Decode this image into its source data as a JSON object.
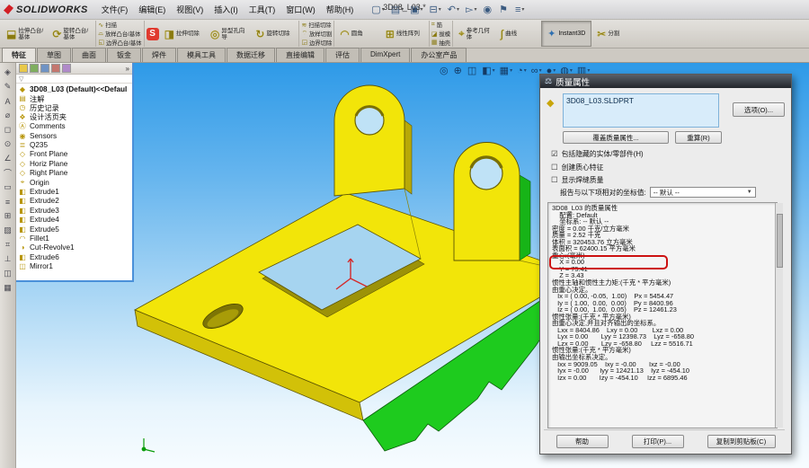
{
  "window": {
    "logo": "SOLIDWORKS",
    "doc_title": "3D08_L03 *"
  },
  "menus": [
    "文件(F)",
    "编辑(E)",
    "视图(V)",
    "插入(I)",
    "工具(T)",
    "窗口(W)",
    "帮助(H)"
  ],
  "std_toolbar": [
    {
      "glyph": "▢",
      "caret": "▾"
    },
    {
      "glyph": "▤",
      "caret": "▾"
    },
    {
      "glyph": "▣",
      "caret": "▾"
    },
    {
      "glyph": "⊟",
      "caret": "▾"
    },
    {
      "glyph": "↶",
      "caret": "▾"
    },
    {
      "glyph": "▻",
      "caret": "▾"
    },
    {
      "glyph": "◉",
      "caret": ""
    },
    {
      "glyph": "⚑",
      "caret": ""
    },
    {
      "glyph": "≡",
      "caret": "▾"
    }
  ],
  "features_toolbar": {
    "big1": [
      {
        "glyph": "⬓",
        "label": "拉伸凸台/基体"
      },
      {
        "glyph": "⟳",
        "label": "旋转凸台/基体"
      }
    ],
    "stack1": [
      {
        "glyph": "∿",
        "label": "扫描"
      },
      {
        "glyph": "⌓",
        "label": "放样凸台/基体"
      },
      {
        "glyph": "◱",
        "label": "边界凸台/基体"
      }
    ],
    "big2": [
      {
        "glyph": "◨",
        "label": "拉伸切除"
      },
      {
        "glyph": "◎",
        "label": "异型孔向导"
      },
      {
        "glyph": "↻",
        "label": "旋转切除"
      }
    ],
    "stack2": [
      {
        "glyph": "≋",
        "label": "扫描切除"
      },
      {
        "glyph": "⌔",
        "label": "放样切割"
      },
      {
        "glyph": "◲",
        "label": "边界切除"
      }
    ],
    "big3": [
      {
        "glyph": "◠",
        "label": "圆角"
      },
      {
        "glyph": "⊞",
        "label": "线性阵列"
      }
    ],
    "stack3": [
      {
        "glyph": "⌗",
        "label": "筋"
      },
      {
        "glyph": "◪",
        "label": "拔模"
      },
      {
        "glyph": "▦",
        "label": "抽壳"
      }
    ],
    "big4": [
      {
        "glyph": "⌖",
        "label": "参考几何体"
      },
      {
        "glyph": "∫",
        "label": "曲线"
      }
    ],
    "addin_badge": "S",
    "instant3d_label": "Instant3D",
    "split_label": "分割"
  },
  "command_tabs": {
    "active": "特征",
    "others": [
      "草图",
      "曲面",
      "钣金",
      "焊件",
      "模具工具",
      "数据迁移",
      "直接编辑",
      "评估",
      "DimXpert",
      "办公室产品"
    ]
  },
  "left_strip": [
    "◈",
    "✎",
    "A",
    "⌀",
    "◻",
    "⊙",
    "∠",
    "⌒",
    "▭",
    "≡",
    "⊞",
    "▨",
    "⌗",
    "⊥",
    "◫",
    "▦"
  ],
  "feature_tree": {
    "chevron": "»",
    "filter_glyph": "▽",
    "root": "3D08_L03 (Default)<<Defaul",
    "items": [
      {
        "icon": "▤",
        "label": "注解",
        "plane": false
      },
      {
        "icon": "◷",
        "label": "历史记录",
        "plane": false
      },
      {
        "icon": "❖",
        "label": "设计活页夹",
        "plane": false
      },
      {
        "icon": "Ⓐ",
        "label": "Comments",
        "plane": false
      },
      {
        "icon": "◉",
        "label": "Sensors",
        "plane": false
      },
      {
        "icon": "≣",
        "label": "Q235",
        "plane": false
      },
      {
        "icon": "◇",
        "label": "Front Plane",
        "plane": true
      },
      {
        "icon": "◇",
        "label": "Horiz Plane",
        "plane": true
      },
      {
        "icon": "◇",
        "label": "Right Plane",
        "plane": true
      },
      {
        "icon": "⌖",
        "label": "Origin",
        "plane": true
      },
      {
        "icon": "◧",
        "label": "Extrude1",
        "plane": false
      },
      {
        "icon": "◧",
        "label": "Extrude2",
        "plane": false
      },
      {
        "icon": "◧",
        "label": "Extrude3",
        "plane": false
      },
      {
        "icon": "◧",
        "label": "Extrude4",
        "plane": false
      },
      {
        "icon": "◧",
        "label": "Extrude5",
        "plane": false
      },
      {
        "icon": "◠",
        "label": "Fillet1",
        "plane": false
      },
      {
        "icon": "◑",
        "label": "Cut-Revolve1",
        "plane": false
      },
      {
        "icon": "◧",
        "label": "Extrude6",
        "plane": false
      },
      {
        "icon": "◫",
        "label": "Mirror1",
        "plane": false
      }
    ]
  },
  "view_toolbar": [
    {
      "glyph": "◎",
      "caret": ""
    },
    {
      "glyph": "⊕",
      "caret": ""
    },
    {
      "glyph": "◫",
      "caret": ""
    },
    {
      "glyph": "◧",
      "caret": "▾"
    },
    {
      "glyph": "▦",
      "caret": "▾"
    },
    {
      "glyph": "◔",
      "caret": "▾"
    },
    {
      "glyph": "∞",
      "caret": "▾"
    },
    {
      "glyph": "●",
      "caret": "▾"
    },
    {
      "glyph": "◍",
      "caret": "▾"
    },
    {
      "glyph": "▥",
      "caret": "▾"
    }
  ],
  "dialog": {
    "title": "质量属性",
    "file_name": "3D08_L03.SLDPRT",
    "options_button": "选项(O)...",
    "override_button": "覆盖质量属性...",
    "recalculate_button": "重算(R)",
    "checkboxes": [
      {
        "box": "☑",
        "label": "包括隐藏的实体/零部件(H)"
      },
      {
        "box": "☐",
        "label": "创建质心特征"
      },
      {
        "box": "☐",
        "label": "显示焊缝质量"
      }
    ],
    "coord_label": "报告与以下项相对的坐标值:",
    "coord_value": "-- 默认 --",
    "results": [
      "3D08_L03 的质量属性",
      "    配置: Default",
      "    坐标系: -- 默认 --",
      "",
      "密度 = 0.00 千克/立方毫米",
      "",
      "质量 = 2.52 千克",
      "",
      "体积 = 320453.76 立方毫米",
      "",
      "表面积 = 62400.15 平方毫米",
      "",
      "重心:(毫米)",
      "    X = 0.00",
      "    Y = 75.41",
      "    Z = 3.43",
      "",
      "惯性主轴和惯性主力矩:(千克 * 平方毫米)",
      "由重心决定。",
      "   Ix = ( 0.00, -0.05,  1.00)    Px = 5454.47",
      "   Iy = ( 1.00,  0.00,  0.00)    Py = 8400.96",
      "   Iz = ( 0.00,  1.00,  0.05)    Pz = 12461.23",
      "",
      "惯性张量:(千克 * 平方毫米)",
      "由重心决定,并且对齐输出的坐标系。",
      "   Lxx = 8404.86    Lxy = 0.00        Lxz = 0.00",
      "   Lyx = 0.00       Lyy = 12398.73    Lyz = -658.80",
      "   Lzx = 0.00       Lzy = -658.80     Lzz = 5516.71",
      "",
      "惯性张量:(千克 * 平方毫米)",
      "由输出坐标系决定。",
      "   Ixx = 9009.05    Ixy = -0.00       Ixz = -0.00",
      "   Iyx = -0.00      Iyy = 12421.13    Iyz = -454.10",
      "   Izx = 0.00       Izy = -454.10     Izz = 6895.46"
    ],
    "footer_buttons": {
      "help": "帮助",
      "print": "打印(P)...",
      "copy": "复制到剪贴板(C)"
    }
  },
  "colors": {
    "part_yellow": "#f2e509",
    "part_yellow_dark": "#d2c108",
    "part_green": "#1ecb1e",
    "hole_blue": "#a6d4f0",
    "highlight_red": "#cc1111",
    "viewport_top": "#2e9ae8",
    "viewport_bottom": "#f7fcff"
  }
}
